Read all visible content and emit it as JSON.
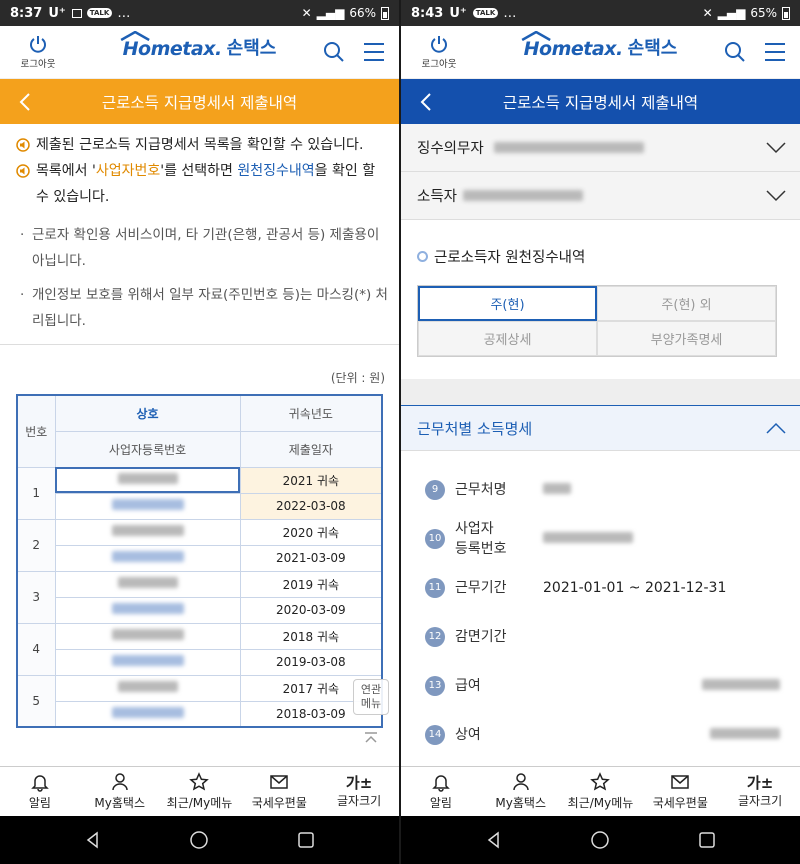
{
  "left": {
    "status": {
      "time": "8:37",
      "carrier": "U⁺",
      "battery": "66%"
    },
    "header": {
      "logout": "로그아웃",
      "logo_brand": "Hometax.",
      "logo_kor": "손택스"
    },
    "title": "근로소득 지급명세서 제출내역",
    "notices": [
      "제출된 근로소득 지급명세서 목록을 확인할 수 있습니다."
    ],
    "notice2": {
      "pre": "목록에서 '",
      "hl1": "사업자번호",
      "mid": "'를 선택하면 ",
      "hl2": "원천징수내역",
      "post": "을 확인 할 수 있습니다."
    },
    "bullets": [
      "근로자 확인용 서비스이며, 타 기관(은행, 관공서 등) 제출용이 아닙니다.",
      "개인정보 보호를 위해서 일부 자료(주민번호 등)는 마스킹(*) 처리됩니다."
    ],
    "unit": "(단위 : 원)",
    "table": {
      "h_num": "번호",
      "h_name": "상호",
      "h_bizno": "사업자등록번호",
      "h_year": "귀속년도",
      "h_date": "제출일자",
      "rows": [
        {
          "num": "1",
          "year": "2021 귀속",
          "date": "2022-03-08"
        },
        {
          "num": "2",
          "year": "2020 귀속",
          "date": "2021-03-09"
        },
        {
          "num": "3",
          "year": "2019 귀속",
          "date": "2020-03-09"
        },
        {
          "num": "4",
          "year": "2018 귀속",
          "date": "2019-03-08"
        },
        {
          "num": "5",
          "year": "2017 귀속",
          "date": "2018-03-09"
        }
      ]
    },
    "floating_menu": "연관\n메뉴",
    "tabbar": [
      "알림",
      "My홈택스",
      "최근/My메뉴",
      "국세우편물",
      "글자크기"
    ]
  },
  "right": {
    "status": {
      "time": "8:43",
      "carrier": "U⁺",
      "battery": "65%"
    },
    "header": {
      "logout": "로그아웃",
      "logo_brand": "Hometax.",
      "logo_kor": "손택스"
    },
    "title": "근로소득 지급명세서 제출내역",
    "acc1": "징수의무자",
    "acc2": "소득자",
    "sub_title": "근로소득자 원천징수내역",
    "tabs": [
      "주(현)",
      "주(현) 외",
      "공제상세",
      "부양가족명세"
    ],
    "section": "근무처별 소득명세",
    "details": [
      {
        "n": "9",
        "label": "근무처명",
        "value": ""
      },
      {
        "n": "10",
        "label": "사업자\n등록번호",
        "value": ""
      },
      {
        "n": "11",
        "label": "근무기간",
        "value": "2021-01-01 ~ 2021-12-31"
      },
      {
        "n": "12",
        "label": "감면기간",
        "value": ""
      },
      {
        "n": "13",
        "label": "급여",
        "value": ""
      },
      {
        "n": "14",
        "label": "상여",
        "value": ""
      }
    ],
    "tabbar": [
      "알림",
      "My홈택스",
      "최근/My메뉴",
      "국세우편물",
      "글자크기"
    ]
  }
}
